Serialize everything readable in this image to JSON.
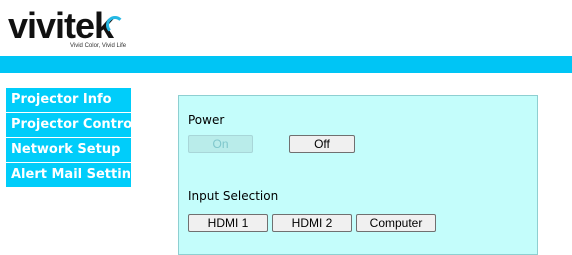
{
  "brand": {
    "logo_text": "vivitek",
    "tagline": "Vivid Color, Vivid Life",
    "accent": "#00c5f5"
  },
  "nav": {
    "items": [
      {
        "label": "Projector Info"
      },
      {
        "label": "Projector Control"
      },
      {
        "label": "Network Setup"
      },
      {
        "label": "Alert Mail Settings"
      }
    ]
  },
  "power": {
    "label": "Power",
    "on_label": "On",
    "off_label": "Off"
  },
  "input": {
    "label": "Input Selection",
    "options": [
      {
        "label": "HDMI 1"
      },
      {
        "label": "HDMI 2"
      },
      {
        "label": "Computer"
      }
    ]
  }
}
